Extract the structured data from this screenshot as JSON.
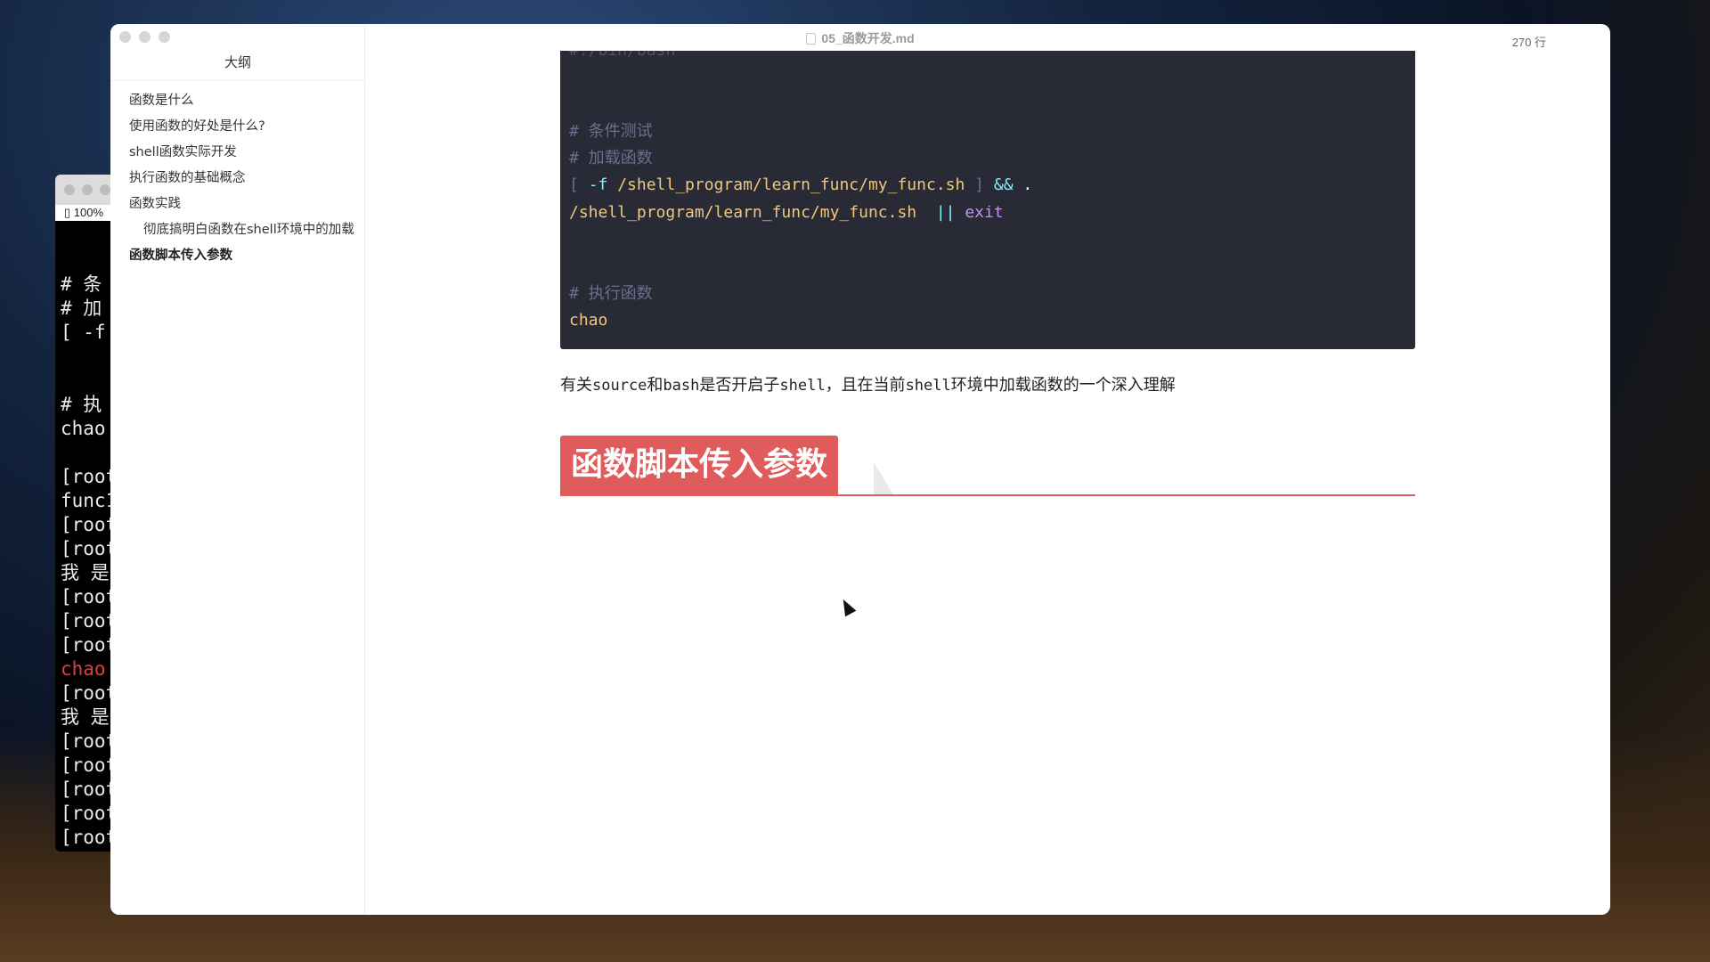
{
  "terminal": {
    "zoom": "100%",
    "lines": [
      {
        "text": "# 条 件",
        "style": "normal"
      },
      {
        "text": "# 加 载",
        "style": "normal"
      },
      {
        "text": "[ -f",
        "style": "normal"
      },
      {
        "text": "",
        "style": "gap"
      },
      {
        "text": "",
        "style": "gap"
      },
      {
        "text": "# 执 行",
        "style": "normal"
      },
      {
        "text": "chao",
        "style": "normal"
      },
      {
        "text": "",
        "style": "gap"
      },
      {
        "text": "[root",
        "style": "normal"
      },
      {
        "text": "func1",
        "style": "normal"
      },
      {
        "text": "[root",
        "style": "normal"
      },
      {
        "text": "[root",
        "style": "normal"
      },
      {
        "text": "我 是 函",
        "style": "normal"
      },
      {
        "text": "[root",
        "style": "normal"
      },
      {
        "text": "[root",
        "style": "normal"
      },
      {
        "text": "[root",
        "style": "normal"
      },
      {
        "text": "chao",
        "style": "red"
      },
      {
        "text": "[root",
        "style": "normal"
      },
      {
        "text": "我 是 函",
        "style": "normal"
      },
      {
        "text": "[root",
        "style": "normal"
      },
      {
        "text": "[root",
        "style": "normal"
      },
      {
        "text": "[root",
        "style": "normal"
      },
      {
        "text": "[root",
        "style": "normal"
      },
      {
        "text": "[root",
        "style": "normal"
      }
    ]
  },
  "window": {
    "title": "05_函数开发.md",
    "line_count": "270 行"
  },
  "sidebar": {
    "title": "大纲",
    "items": [
      {
        "label": "函数是什么",
        "level": 1,
        "active": false
      },
      {
        "label": "使用函数的好处是什么?",
        "level": 1,
        "active": false
      },
      {
        "label": "shell函数实际开发",
        "level": 1,
        "active": false
      },
      {
        "label": "执行函数的基础概念",
        "level": 1,
        "active": false
      },
      {
        "label": "函数实践",
        "level": 1,
        "active": false
      },
      {
        "label": "彻底搞明白函数在shell环境中的加载",
        "level": 2,
        "active": false
      },
      {
        "label": "函数脚本传入参数",
        "level": 1,
        "active": true
      }
    ]
  },
  "code": {
    "shebang": "#!/bin/bash",
    "comment_test": "# 条件测试",
    "comment_load": "# 加载函数",
    "bracket_open": "[ ",
    "flag": "-f ",
    "path1": "/shell_program/learn_func/my_func.sh",
    "bracket_close": " ] ",
    "and_op": "&&",
    "dot": " .",
    "path2": "/shell_program/learn_func/my_func.sh",
    "or_op": "  ||",
    "exit_kw": " exit",
    "comment_exec": "# 执行函数",
    "call": "chao"
  },
  "paragraph": {
    "p1": "有关",
    "c1": "source",
    "p2": "和",
    "c2": "bash",
    "p3": "是否开启子",
    "c3": "shell",
    "p4": "，且在当前",
    "c4": "shell",
    "p5": "环境中加载函数的一个深入理解"
  },
  "heading": "函数脚本传入参数",
  "colors": {
    "heading_bg": "#e05c5c",
    "code_bg": "#282a36"
  }
}
